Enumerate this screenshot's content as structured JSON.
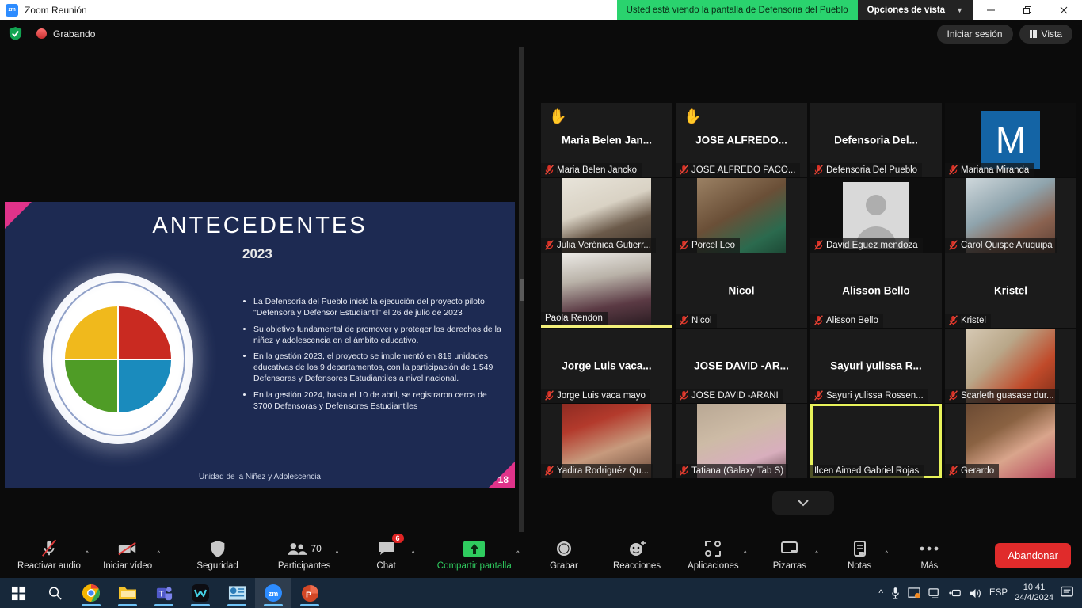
{
  "titlebar": {
    "app_icon": "zoom-logo-icon",
    "title": "Zoom Reunión",
    "share_banner": "Usted está viendo la pantalla de Defensoria del Pueblo",
    "view_options": "Opciones de vista",
    "minimize": "—",
    "maximize": "❐",
    "close": "✕"
  },
  "recordbar": {
    "recording_label": "Grabando",
    "signin_label": "Iniciar sesión",
    "view_label": "Vista"
  },
  "slide": {
    "title": "ANTECEDENTES",
    "year": "2023",
    "bullets": [
      "La Defensoría del Pueblo inició la ejecución del proyecto piloto \"Defensora y Defensor Estudiantil\" el 26 de julio de 2023",
      "Su objetivo fundamental de promover y proteger los derechos de la niñez y adolescencia en el ámbito educativo.",
      "En la gestión 2023, el proyecto se implementó en 819 unidades educativas de los 9 departamentos, con la participación de 1.549 Defensoras y Defensores Estudiantiles a nivel nacional.",
      "En la gestión 2024, hasta el 10 de abril, se registraron cerca de 3700 Defensoras y Defensores Estudiantiles"
    ],
    "footer": "Unidad de la Niñez y Adolescencia",
    "page_number": "18"
  },
  "participants": [
    {
      "name": "Maria Belen Jancko",
      "display": "Maria Belen Jan...",
      "kind": "name",
      "muted": true,
      "hand": true,
      "speaking": false
    },
    {
      "name": "JOSE ALFREDO PACO...",
      "display": "JOSE ALFREDO...",
      "kind": "name",
      "muted": true,
      "hand": true,
      "speaking": false
    },
    {
      "name": "Defensoria Del Pueblo",
      "display": "Defensoria Del...",
      "kind": "name",
      "muted": true,
      "hand": false,
      "speaking": false
    },
    {
      "name": "Mariana Miranda",
      "display": "M",
      "kind": "letter",
      "letter": "M",
      "muted": true,
      "hand": false,
      "speaking": false
    },
    {
      "name": "Julia Verónica Gutierr...",
      "display": "",
      "kind": "video",
      "video": "woman-glasses",
      "muted": true,
      "hand": false,
      "speaking": false
    },
    {
      "name": "Porcel Leo",
      "display": "",
      "kind": "video",
      "video": "boy-room",
      "muted": true,
      "hand": false,
      "speaking": false
    },
    {
      "name": "David Eguez mendoza",
      "display": "",
      "kind": "avatar",
      "muted": true,
      "hand": false,
      "speaking": false
    },
    {
      "name": "Carol Quispe Aruquipa",
      "display": "",
      "kind": "video",
      "video": "woman-ceiling",
      "muted": true,
      "hand": false,
      "speaking": false
    },
    {
      "name": "Paola Rendon",
      "display": "",
      "kind": "video",
      "video": "woman-window",
      "muted": false,
      "hand": false,
      "speaking": true
    },
    {
      "name": "Nicol",
      "display": "Nicol",
      "kind": "name",
      "muted": true,
      "hand": false,
      "speaking": false
    },
    {
      "name": "Alisson Bello",
      "display": "Alisson Bello",
      "kind": "name",
      "muted": true,
      "hand": false,
      "speaking": false
    },
    {
      "name": "Kristel",
      "display": "Kristel",
      "kind": "name",
      "muted": true,
      "hand": false,
      "speaking": false
    },
    {
      "name": "Jorge Luis vaca mayo",
      "display": "Jorge Luis vaca...",
      "kind": "name",
      "muted": true,
      "hand": false,
      "speaking": false
    },
    {
      "name": "JOSE DAVID -ARANI",
      "display": "JOSE DAVID -AR...",
      "kind": "name",
      "muted": true,
      "hand": false,
      "speaking": false
    },
    {
      "name": "Sayuri yulissa Rossen...",
      "display": "Sayuri yulissa R...",
      "kind": "name",
      "muted": true,
      "hand": false,
      "speaking": false
    },
    {
      "name": "Scarleth guasase dur...",
      "display": "",
      "kind": "video",
      "video": "shop-window",
      "muted": true,
      "hand": false,
      "speaking": false
    },
    {
      "name": "Yadira Rodriguéz Qu...",
      "display": "",
      "kind": "video",
      "video": "red-roof",
      "muted": true,
      "hand": false,
      "speaking": false
    },
    {
      "name": "Tatiana (Galaxy Tab S)",
      "display": "",
      "kind": "video",
      "video": "tablet-girl",
      "muted": true,
      "hand": false,
      "speaking": false
    },
    {
      "name": "Ilcen Aimed Gabriel Rojas",
      "display": "",
      "kind": "dark",
      "muted": false,
      "hand": false,
      "speaking": true
    },
    {
      "name": "Gerardo",
      "display": "",
      "kind": "video",
      "video": "boy-wood",
      "muted": true,
      "hand": false,
      "speaking": false
    }
  ],
  "grid": {
    "show_more_icon": "chevron-down-icon"
  },
  "toolbar": {
    "items": [
      {
        "label": "Reactivar audio",
        "icon": "microphone-muted-icon",
        "caret": true
      },
      {
        "label": "Iniciar vídeo",
        "icon": "camera-muted-icon",
        "caret": true
      },
      {
        "label": "Seguridad",
        "icon": "shield-icon",
        "caret": false
      },
      {
        "label": "Participantes",
        "icon": "participants-icon",
        "caret": true,
        "count": "70"
      },
      {
        "label": "Chat",
        "icon": "chat-icon",
        "caret": true,
        "badge": "6"
      },
      {
        "label": "Compartir pantalla",
        "icon": "share-screen-icon",
        "caret": true,
        "highlight": true
      },
      {
        "label": "Grabar",
        "icon": "record-icon",
        "caret": false
      },
      {
        "label": "Reacciones",
        "icon": "reactions-icon",
        "caret": false
      },
      {
        "label": "Aplicaciones",
        "icon": "apps-icon",
        "caret": true
      },
      {
        "label": "Pizarras",
        "icon": "whiteboard-icon",
        "caret": true
      },
      {
        "label": "Notas",
        "icon": "notes-icon",
        "caret": true
      },
      {
        "label": "Más",
        "icon": "more-dots-icon",
        "caret": false
      }
    ],
    "leave_label": "Abandonar",
    "accent_green": "#2fcc5f",
    "leave_red": "#e02b2b"
  },
  "taskbar": {
    "apps": [
      {
        "name": "start-button",
        "icon": "windows-logo-icon"
      },
      {
        "name": "search-button",
        "icon": "search-icon"
      },
      {
        "name": "chrome",
        "icon": "chrome-icon"
      },
      {
        "name": "file-explorer",
        "icon": "folder-icon"
      },
      {
        "name": "teams",
        "icon": "teams-icon"
      },
      {
        "name": "whatsapp-w",
        "icon": "w-app-icon"
      },
      {
        "name": "publisher",
        "icon": "publisher-icon"
      },
      {
        "name": "zoom",
        "icon": "zoom-icon"
      },
      {
        "name": "powerpoint",
        "icon": "powerpoint-icon"
      }
    ],
    "tray": {
      "chevron": "^",
      "mic": "microphone-icon",
      "display": "display-icon",
      "network": "network-icon",
      "usb": "usb-icon",
      "volume": "volume-icon",
      "language": "ESP",
      "time": "10:41",
      "date": "24/4/2024",
      "notifications": "notifications-icon"
    }
  }
}
